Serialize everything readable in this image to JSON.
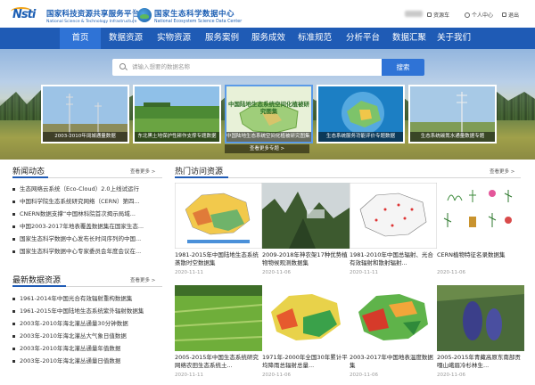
{
  "header": {
    "org1_cn": "国家科技资源共享服务平台",
    "org1_en": "National Science & Technology Infrastructure",
    "org2_cn": "国家生态科学数据中心",
    "org2_en": "National Ecosystem Science Data Center",
    "logo_text": "Nsti",
    "util": {
      "cart": "资源车",
      "user_center": "个人中心",
      "logout": "退出"
    }
  },
  "nav": [
    "首页",
    "数据资源",
    "实物资源",
    "服务案例",
    "服务成效",
    "标准规范",
    "分析平台",
    "数据汇聚",
    "关于我们"
  ],
  "search": {
    "placeholder": "请输入想要的数据名称",
    "button": "搜索"
  },
  "slides": [
    {
      "caption": "2003-2010年阔城通量数据"
    },
    {
      "caption": "东北黑土地保护性耕作支撑专题数据"
    },
    {
      "caption": "中国陆地生态系统空间化植被研究图集（1971-2000年）",
      "overlay": "中国陆地生态系统空间化植被研究图集"
    },
    {
      "caption": "生态系统服务功能评价专题数据"
    },
    {
      "caption": "生态系统碳氮水通量数据专题"
    }
  ],
  "banner_more": "查看更多专题 >",
  "news": {
    "title": "新闻动态",
    "more": "查看更多 >",
    "items": [
      "生态网络云系统（Eco-Cloud）2.0上线试运行",
      "中国科学院生态系统研究网络（CERN）第四...",
      "CNERN数据支撑“中国林科院首次揭示局域...",
      "中国2003-2017年地表覆盖数据集在国家生态...",
      "国家生态科学数据中心发布长时间序列的中国...",
      "国家生态科学数据中心专家委员会年度会议在..."
    ]
  },
  "latest": {
    "title": "最新数据资源",
    "more": "查看更多 >",
    "items": [
      "1961-2014年中国光合有效辐射重构数据集",
      "1961-2015年中国陆地生态系统紫外辐射数据集",
      "2003年-2010年海北灌丛通量30分钟数据",
      "2003年-2010年海北灌丛大气象日值数据",
      "2003年-2010年海北灌丛通量年值数据",
      "2003年-2010年海北灌丛通量日值数据"
    ]
  },
  "hot": {
    "title": "热门访问资源",
    "more": "查看更多 >",
    "cards": [
      {
        "title": "1981-2015年中国陆地生态系统蒸散时空数据集",
        "date": "2020-11-11"
      },
      {
        "title": "2009-2018年神农架17种优势植物物候观测数据集",
        "date": "2020-11-06"
      },
      {
        "title": "1981-2010年中国总辐射、光合有效辐射和散射辐射...",
        "date": "2020-11-11"
      },
      {
        "title": "CERN植物特征名录数据集",
        "date": "2020-11-06"
      },
      {
        "title": "2005-2015年中国生态系统研究网络农田生态系统土...",
        "date": "2020-11-11"
      },
      {
        "title": "1971年-2000年全国30年累计平均降雨总辐射总量...",
        "date": "2020-11-06"
      },
      {
        "title": "2003-2017年中国地表温度数据集",
        "date": "2020-11-06"
      },
      {
        "title": "2005-2015年青藏高原东南部贡嘎山峨眉冷杉林生...",
        "date": "2020-11-06"
      }
    ]
  }
}
